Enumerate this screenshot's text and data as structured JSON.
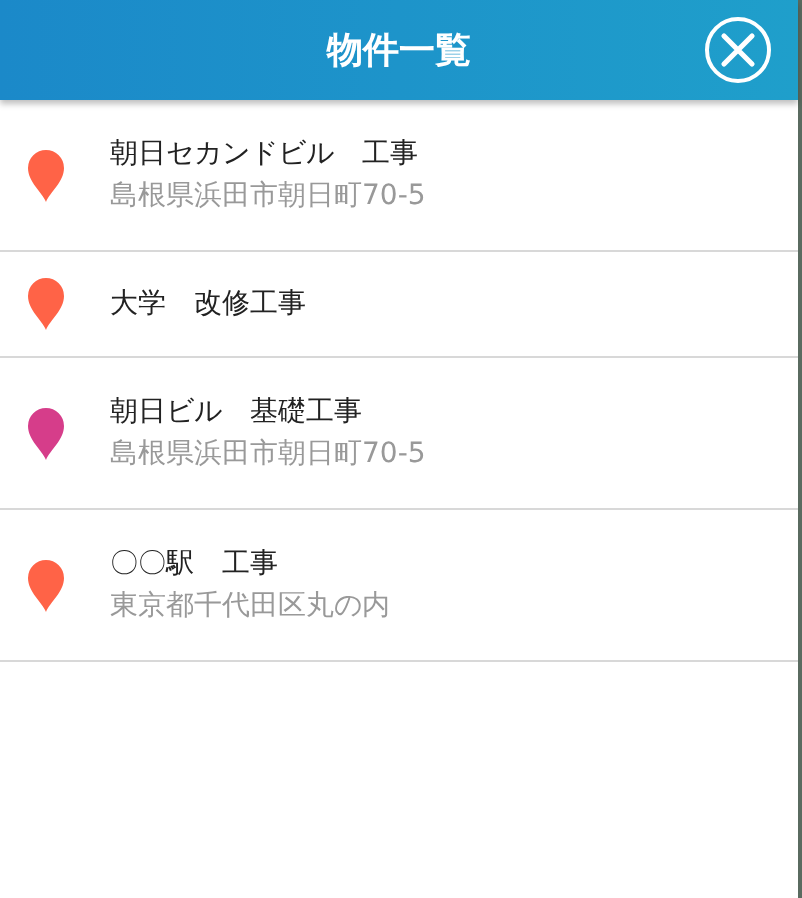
{
  "header": {
    "title": "物件一覧"
  },
  "items": [
    {
      "name": "朝日セカンドビル　工事",
      "address": "島根県浜田市朝日町70-5",
      "color": "#ff6347"
    },
    {
      "name": "大学　改修工事",
      "color": "#ff6347"
    },
    {
      "name": "朝日ビル　基礎工事",
      "address": "島根県浜田市朝日町70-5",
      "color": "#d63d8a"
    },
    {
      "name": "〇〇駅　工事",
      "address": "東京都千代田区丸の内",
      "color": "#ff6347"
    }
  ]
}
